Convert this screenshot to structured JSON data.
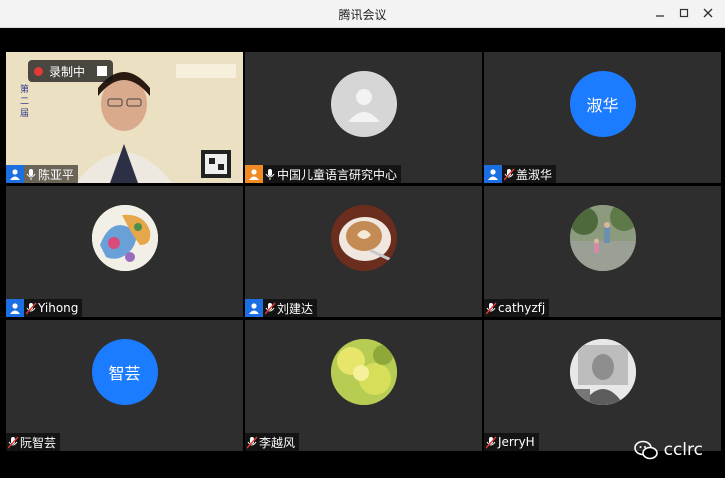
{
  "window": {
    "title": "腾讯会议"
  },
  "recording": {
    "label": "录制中"
  },
  "participants": [
    {
      "name": "陈亚平",
      "icon": "user-icon",
      "icon_color": "#1c6fe0",
      "video": "slide-video",
      "mic": "active"
    },
    {
      "name": "中国儿童语言研究中心",
      "icon": "user-icon",
      "icon_color": "#f08a24",
      "avatar": "default-avatar",
      "mic": "active"
    },
    {
      "name": "盖淑华",
      "icon": "user-icon",
      "icon_color": "#1c6fe0",
      "avatar_text": "淑华",
      "mic": "muted"
    },
    {
      "name": "Yihong",
      "icon": "user-icon",
      "icon_color": "#1c6fe0",
      "avatar": "paisley-photo",
      "mic": "muted"
    },
    {
      "name": "刘建达",
      "icon": "user-icon",
      "icon_color": "#1c6fe0",
      "avatar": "coffee-photo",
      "mic": "muted"
    },
    {
      "name": "cathyzfj",
      "avatar": "park-photo",
      "mic": "muted"
    },
    {
      "name": "阮智芸",
      "avatar_text": "智芸",
      "mic": "muted"
    },
    {
      "name": "李越风",
      "avatar": "flower-photo",
      "mic": "muted"
    },
    {
      "name": "JerryH",
      "avatar": "portrait-photo",
      "mic": "muted"
    }
  ],
  "watermark": {
    "text": "cclrc",
    "icon": "wechat-icon"
  }
}
